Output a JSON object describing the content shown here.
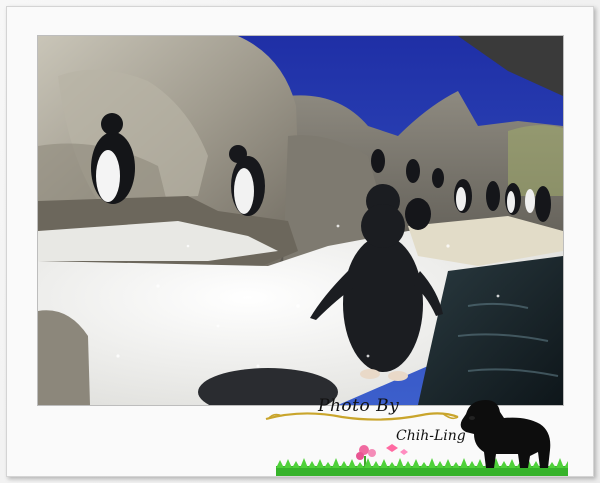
{
  "credit": {
    "photo_by": "Photo By",
    "name": "Chih-Ling"
  },
  "colors": {
    "sky": "#2a3fb8",
    "rock": "#a09a8e",
    "snow": "#f3f3f1",
    "water": "#1c2a30",
    "penguin": "#111318",
    "frame": "#f2f2f2",
    "grass": "#3fbf2e",
    "flourish": "#c9a52c"
  }
}
